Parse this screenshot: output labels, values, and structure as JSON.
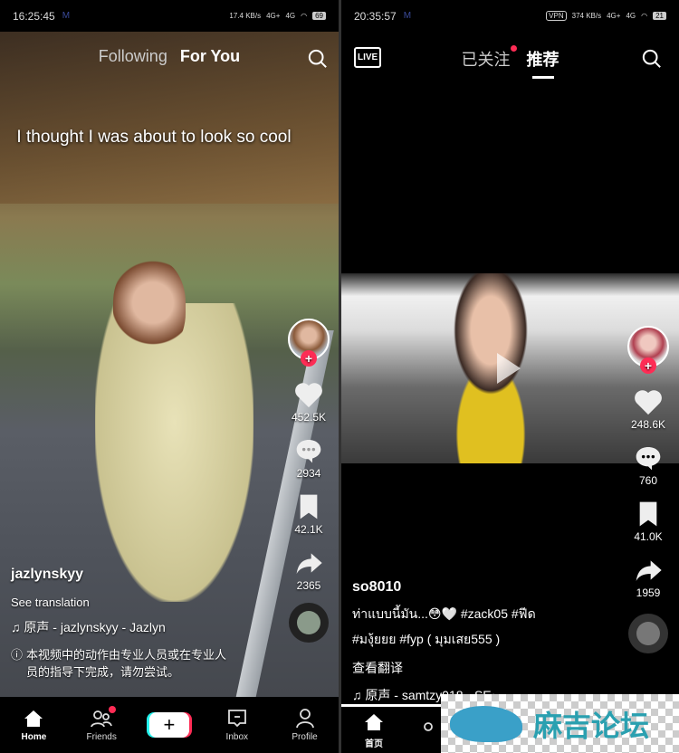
{
  "left": {
    "status": {
      "time": "16:25:45",
      "speed": "17.4 KB/s",
      "net1": "4G+",
      "net2": "4G",
      "battery": "69"
    },
    "tabs": {
      "following": "Following",
      "for_you": "For You"
    },
    "caption": "I thought I was about to look so cool",
    "actions": {
      "likes": "452.5K",
      "comments": "2934",
      "saves": "42.1K",
      "shares": "2365"
    },
    "info": {
      "username": "jazlynskyy",
      "see_translation": "See translation",
      "sound": "原声 - jazlynskyy - Jazlyn",
      "warning": "本视频中的动作由专业人员或在专业人员的指导下完成，请勿尝试。"
    },
    "nav": {
      "home": "Home",
      "friends": "Friends",
      "inbox": "Inbox",
      "profile": "Profile"
    }
  },
  "right": {
    "status": {
      "time": "20:35:57",
      "vpn": "VPN",
      "speed": "374 KB/s",
      "net1": "4G+",
      "net2": "4G",
      "battery": "21"
    },
    "live": "LIVE",
    "tabs": {
      "following": "已关注",
      "recommended": "推荐"
    },
    "actions": {
      "likes": "248.6K",
      "comments": "760",
      "saves": "41.0K",
      "shares": "1959"
    },
    "info": {
      "username": "so8010",
      "desc1": "ท่าแบบนี้มัน...😳🤍 #zack05 #ฟีด",
      "desc2": "#มงุ้ยยย #fyp ( มุมเสย555 )",
      "see_translation": "查看翻译",
      "sound": "原声 - samtzy018 - SE•..."
    },
    "nav": {
      "home": "首页"
    },
    "watermark": "麻吉论坛"
  },
  "colors": {
    "accent": "#fe2c55",
    "cyan": "#25f4ee"
  }
}
